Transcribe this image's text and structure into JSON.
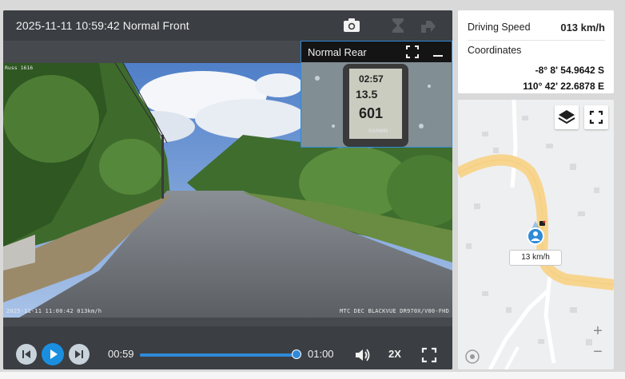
{
  "player": {
    "title": "2025-11-11 10:59:42 Normal Front",
    "icons": {
      "snapshot": "camera-icon",
      "disabled_1": "hourglass-icon",
      "disabled_2": "share-icon"
    },
    "overlay": {
      "top_left": "Russ 1616",
      "bottom_left": "2025-11-11 11:00:42 013km/h",
      "bottom_right": "MTC DEC BLACKVUE DR970X/V00-FHD"
    },
    "rear": {
      "title": "Normal Rear",
      "gps_time": "02:57",
      "gps_speed": "13.5",
      "gps_distance": "601",
      "gps_unit": "km/h",
      "gps_brand": "GARMIN"
    },
    "controls": {
      "current_time": "00:59",
      "total_time": "01:00",
      "progress": 0.98,
      "playback_speed": "2X"
    }
  },
  "info": {
    "speed_label": "Driving Speed",
    "speed_value": "013 km/h",
    "coords_label": "Coordinates",
    "latitude": "-8° 8' 54.9642 S",
    "longitude": "110° 42' 22.6878 E"
  },
  "map": {
    "speed_tag": "13 km/h",
    "zoom_in": "+",
    "zoom_out": "−",
    "colors": {
      "road_main": "#f7d58f",
      "road_minor": "#ffffff",
      "marker": "#2f8ad8"
    }
  },
  "colors": {
    "accent": "#2f8ad8",
    "panel_bg": "#3b3e42"
  }
}
